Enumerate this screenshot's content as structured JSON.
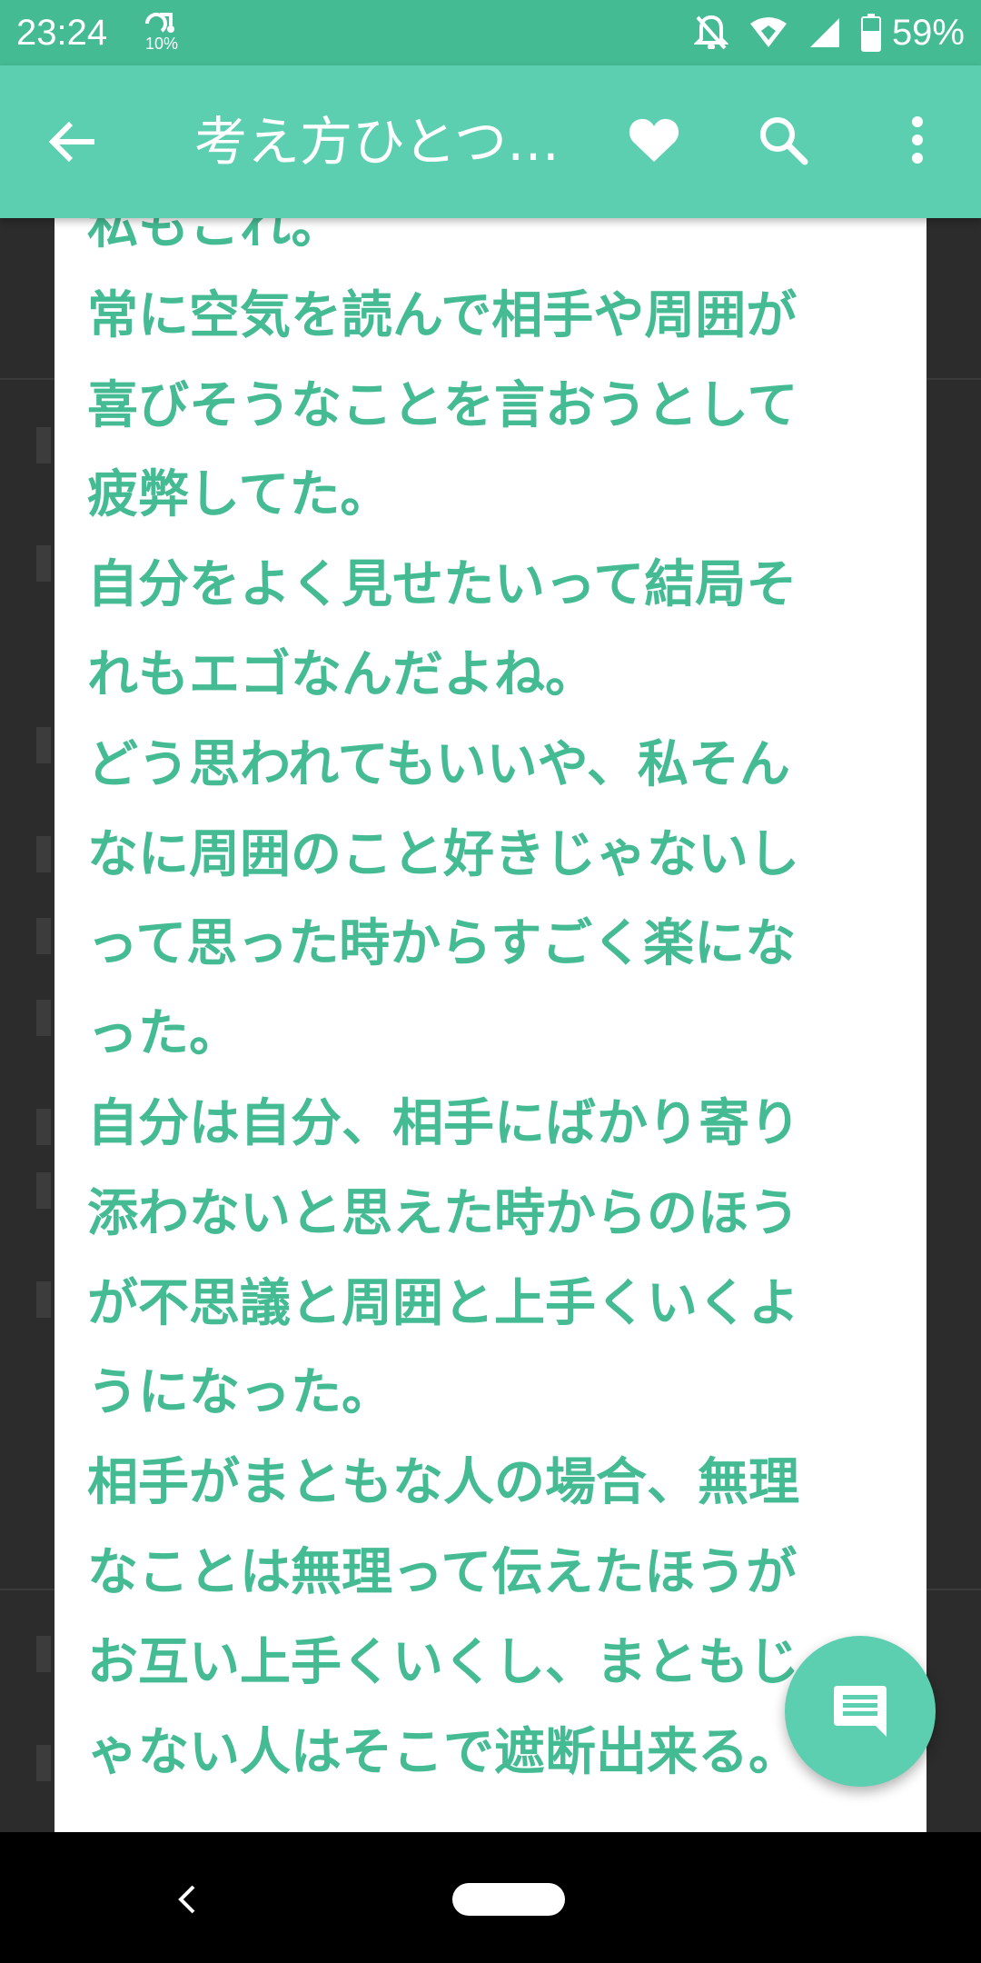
{
  "status_bar": {
    "time": "23:24",
    "data_saver_percent": "10%",
    "battery_percent": "59%",
    "icons": [
      "data-saver-icon",
      "notifications-off-icon",
      "wifi-icon",
      "cellular-signal-icon",
      "battery-icon"
    ]
  },
  "app_bar": {
    "title": "考え方ひとつ…",
    "actions": [
      "back-arrow-icon",
      "heart-icon",
      "search-icon",
      "more-vert-icon"
    ]
  },
  "article": {
    "lines": [
      "私もこれ。",
      "常に空気を読んで相手や周囲が",
      "喜びそうなことを言おうとして",
      "疲弊してた。",
      "自分をよく見せたいって結局そ",
      "れもエゴなんだよね。",
      "どう思われてもいいや、私そん",
      "なに周囲のこと好きじゃないし",
      "って思った時からすごく楽にな",
      "った。",
      "自分は自分、相手にばかり寄り",
      "添わないと思えた時からのほう",
      "が不思議と周囲と上手くいくよ",
      "うになった。",
      "相手がまともな人の場合、無理",
      "なことは無理って伝えたほうが",
      "お互い上手くいくし、まともじ",
      "ゃない人はそこで遮断出来る。"
    ]
  },
  "fab": {
    "icon": "comment-icon"
  },
  "colors": {
    "status_bar": "#45bb94",
    "app_bar": "#5ccfb0",
    "text_accent": "#45bb94",
    "overlay_bg": "#2c2c2c"
  }
}
